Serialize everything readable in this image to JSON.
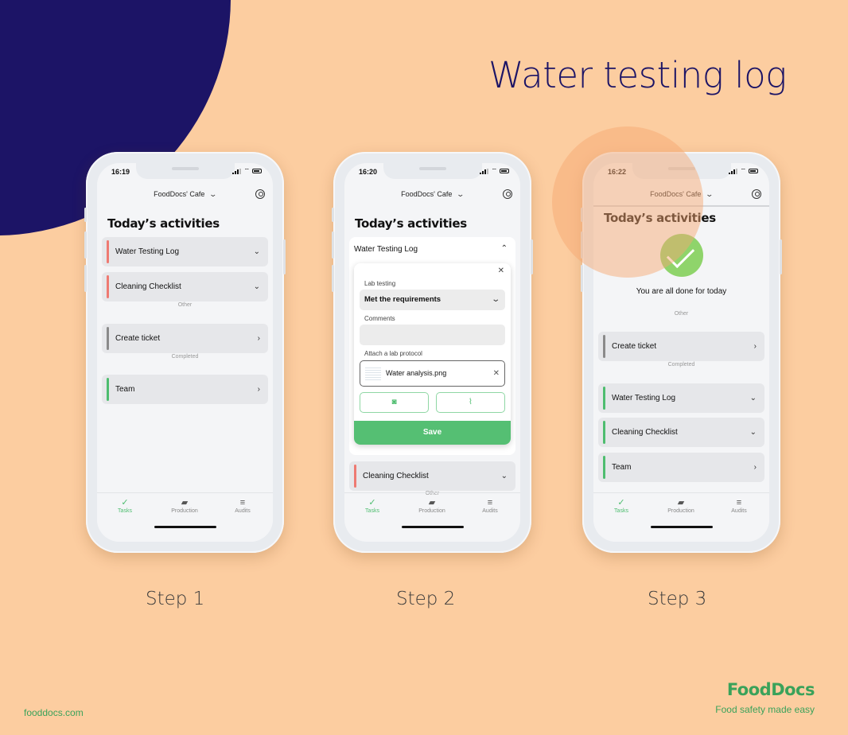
{
  "title": "Water testing log",
  "colors": {
    "background": "#fccda0",
    "navy": "#1c1466",
    "green": "#4ebd6f",
    "pending": "#ee7a72",
    "neutral": "#8a8a8a"
  },
  "common": {
    "venue": "FoodDocs' Cafe",
    "heading": "Today’s activities",
    "tabs": [
      {
        "label": "Tasks",
        "icon": "check-icon"
      },
      {
        "label": "Production",
        "icon": "production-icon"
      },
      {
        "label": "Audits",
        "icon": "audits-icon"
      }
    ]
  },
  "steps": [
    {
      "label": "Step 1",
      "time": "16:19",
      "sections": {
        "other": "Other",
        "completed": "Completed"
      },
      "items": [
        {
          "label": "Water Testing Log",
          "status": "pending",
          "arrow": "chevron-down"
        },
        {
          "label": "Cleaning Checklist",
          "status": "pending",
          "arrow": "chevron-down"
        },
        {
          "label": "Create ticket",
          "status": "neutral",
          "arrow": "chevron-right"
        },
        {
          "label": "Team",
          "status": "done",
          "arrow": "chevron-right"
        }
      ]
    },
    {
      "label": "Step 2",
      "time": "16:20",
      "expanded_item": "Water Testing Log",
      "form": {
        "lab_testing_label": "Lab testing",
        "lab_testing_value": "Met the requirements",
        "comments_label": "Comments",
        "comments_value": "",
        "attach_label": "Attach a lab protocol",
        "attached_file": "Water analysis.png",
        "save_label": "Save"
      },
      "next_item": {
        "label": "Cleaning Checklist",
        "status": "pending"
      },
      "other_label": "Other"
    },
    {
      "label": "Step 3",
      "time": "16:22",
      "done_message": "You are all done for today",
      "sections": {
        "other": "Other",
        "completed": "Completed"
      },
      "items": [
        {
          "label": "Create ticket",
          "status": "neutral",
          "arrow": "chevron-right"
        },
        {
          "label": "Water Testing Log",
          "status": "done",
          "arrow": "chevron-down"
        },
        {
          "label": "Cleaning Checklist",
          "status": "done",
          "arrow": "chevron-down"
        },
        {
          "label": "Team",
          "status": "done",
          "arrow": "chevron-right"
        }
      ]
    }
  ],
  "footer": {
    "website": "fooddocs.com",
    "brand": "FoodDocs",
    "tagline": "Food safety made easy"
  }
}
